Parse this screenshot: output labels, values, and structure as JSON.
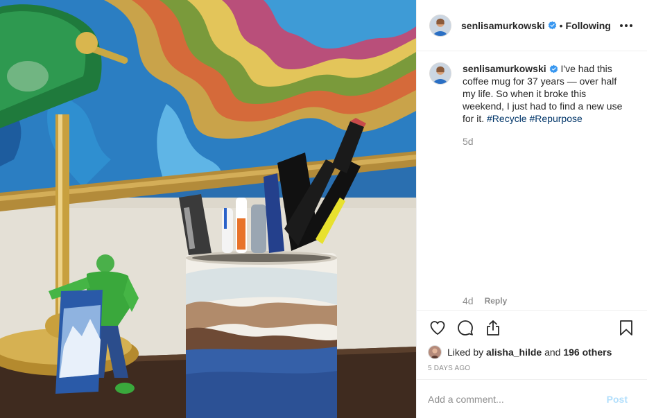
{
  "header": {
    "username": "senlisamurkowski",
    "separator": "•",
    "follow_state": "Following"
  },
  "caption": {
    "username": "senlisamurkowski",
    "text": "I've had this coffee mug for 37 years — over half my life. So when it broke this weekend, I just had to find a new use for it.",
    "hashtags": [
      "#Recycle",
      "#Repurpose"
    ],
    "time": "5d"
  },
  "reply_row": {
    "time": "4d",
    "reply_label": "Reply"
  },
  "likes": {
    "prefix": "Liked by",
    "user": "alisha_hilde",
    "conjunction": "and",
    "others": "196 others"
  },
  "post_date": "5 DAYS AGO",
  "comment": {
    "placeholder": "Add a comment...",
    "post_label": "Post"
  },
  "icons": {
    "verified": "verified-badge-icon",
    "like": "heart-icon",
    "comment": "comment-icon",
    "share": "share-icon",
    "save": "bookmark-icon",
    "more": "more-options-icon"
  },
  "colors": {
    "verified_blue": "#3897f0",
    "hashtag": "#003569",
    "muted_text": "#8e8e8e",
    "post_button_disabled": "#b2dffc"
  }
}
